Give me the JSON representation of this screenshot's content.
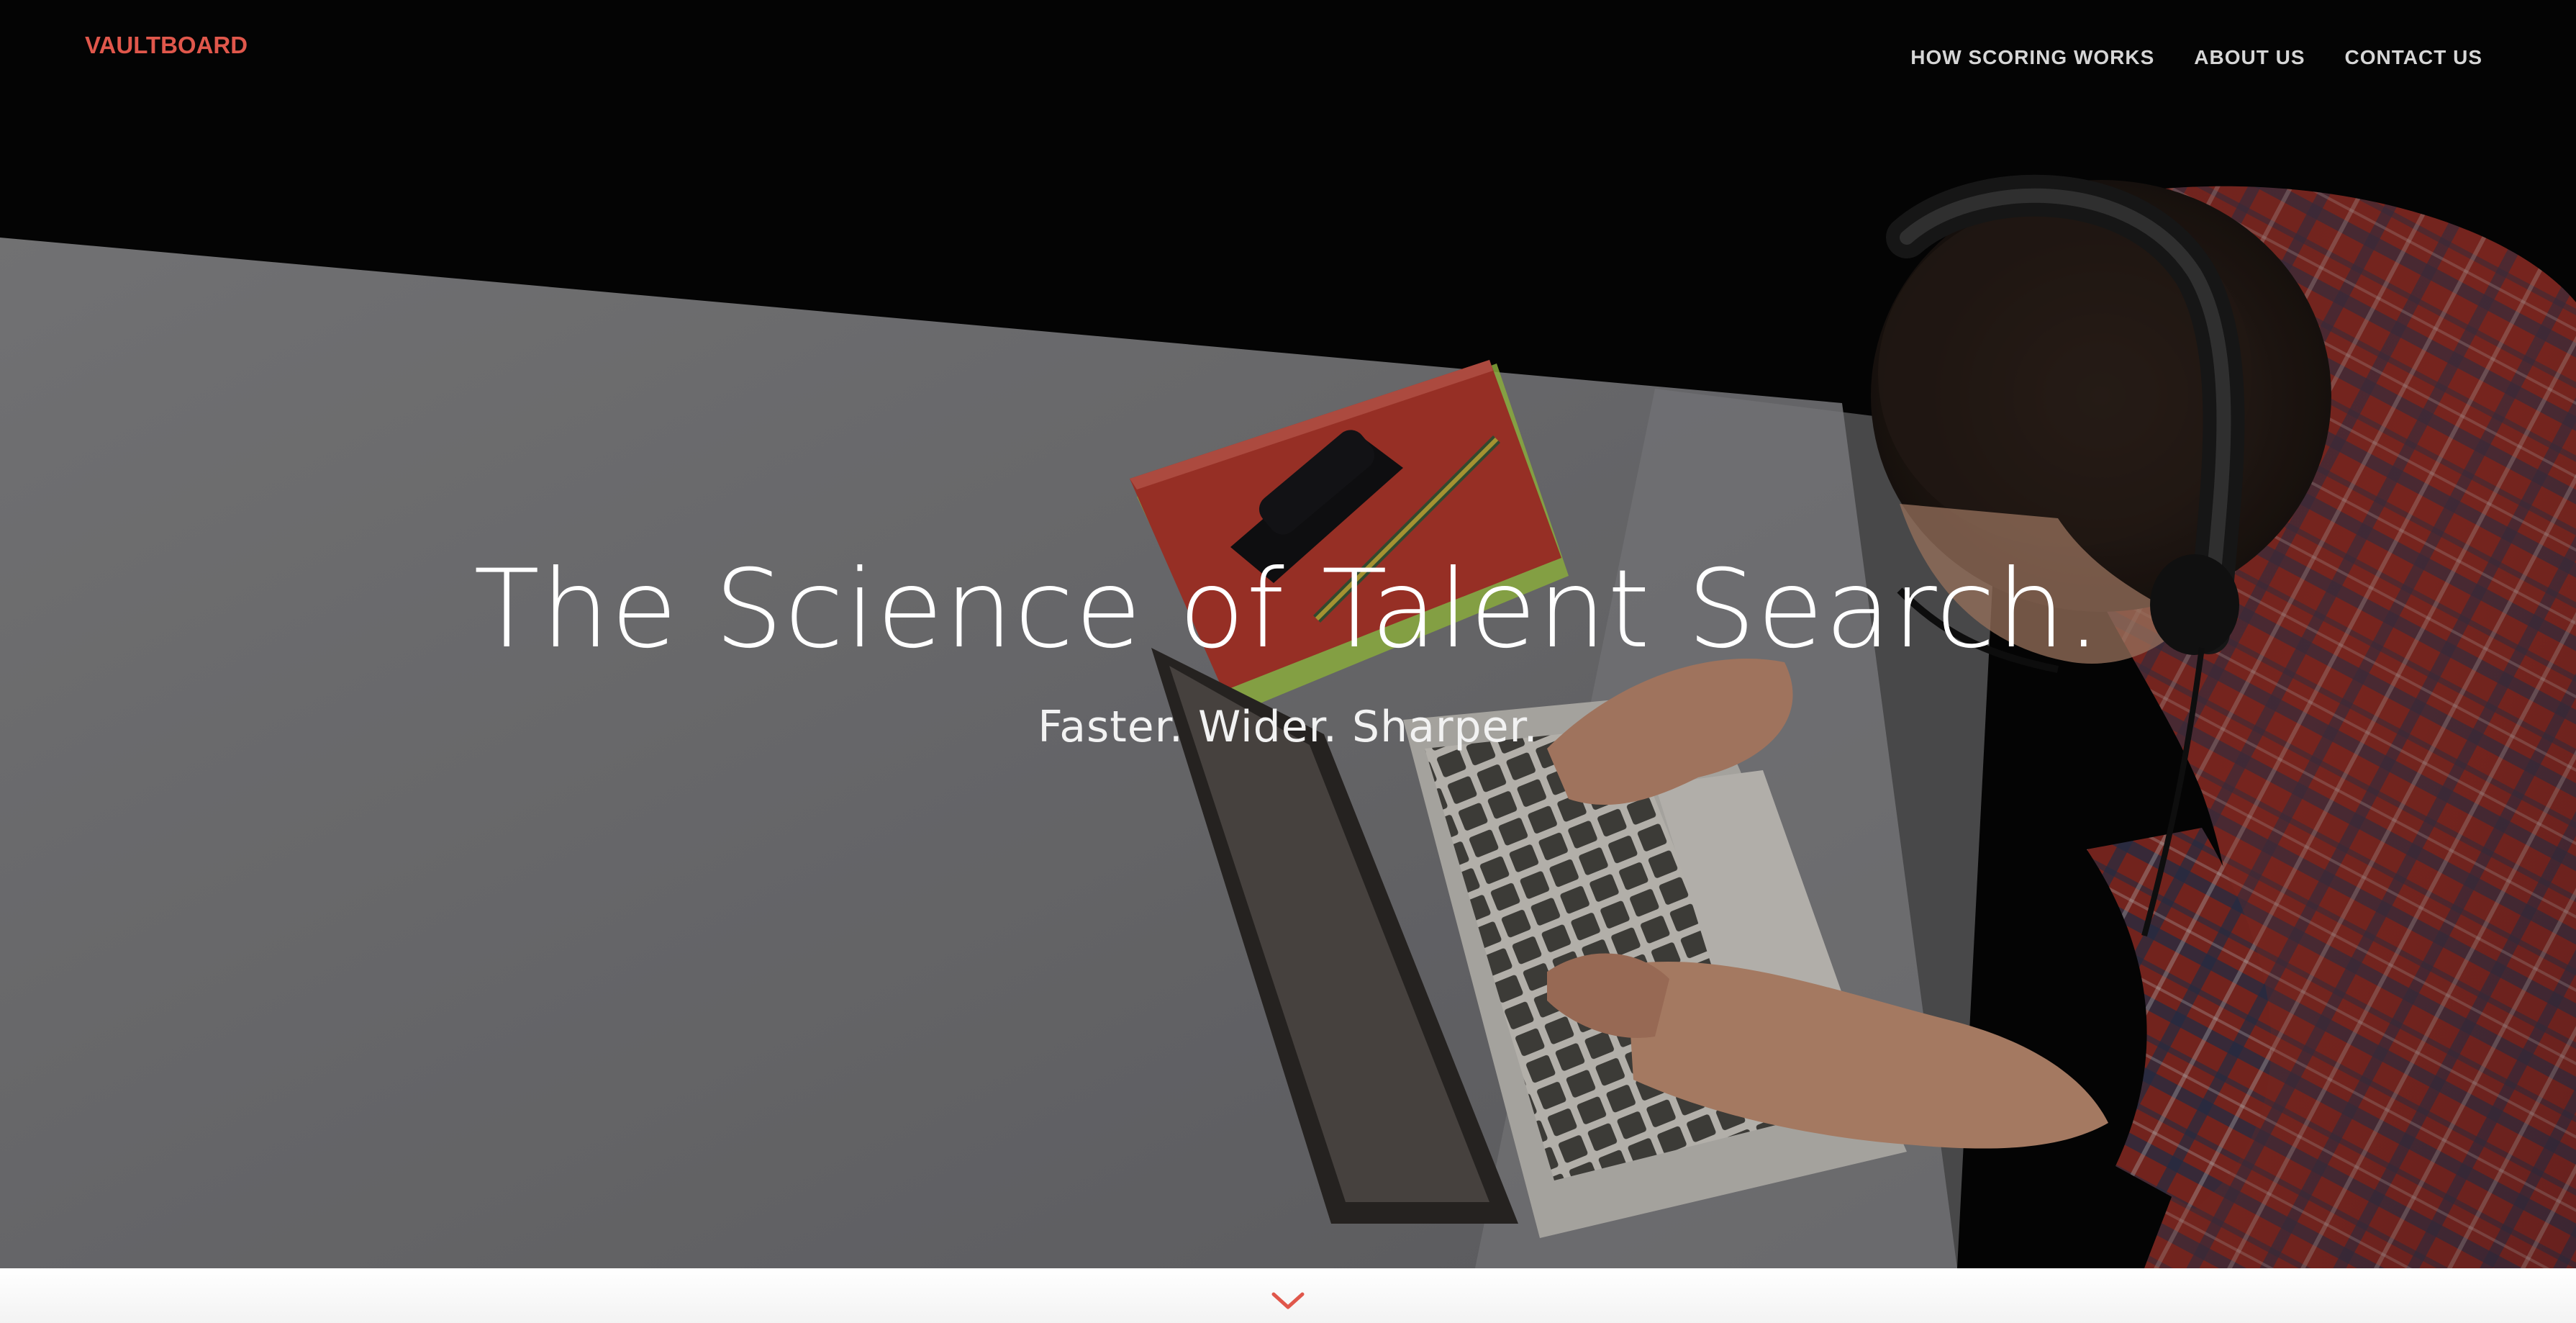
{
  "header": {
    "logo": "VAULTBOARD",
    "nav": [
      {
        "label": "HOW SCORING WORKS"
      },
      {
        "label": "ABOUT US"
      },
      {
        "label": "CONTACT US"
      }
    ]
  },
  "hero": {
    "title": "The Science of Talent Search.",
    "subtitle": "Faster. Wider. Sharper."
  },
  "icons": {
    "scroll": "chevron-down-icon"
  },
  "colors": {
    "brand": "#e0574b",
    "nav_text": "#d6d6d6",
    "hero_text": "#ffffff"
  }
}
